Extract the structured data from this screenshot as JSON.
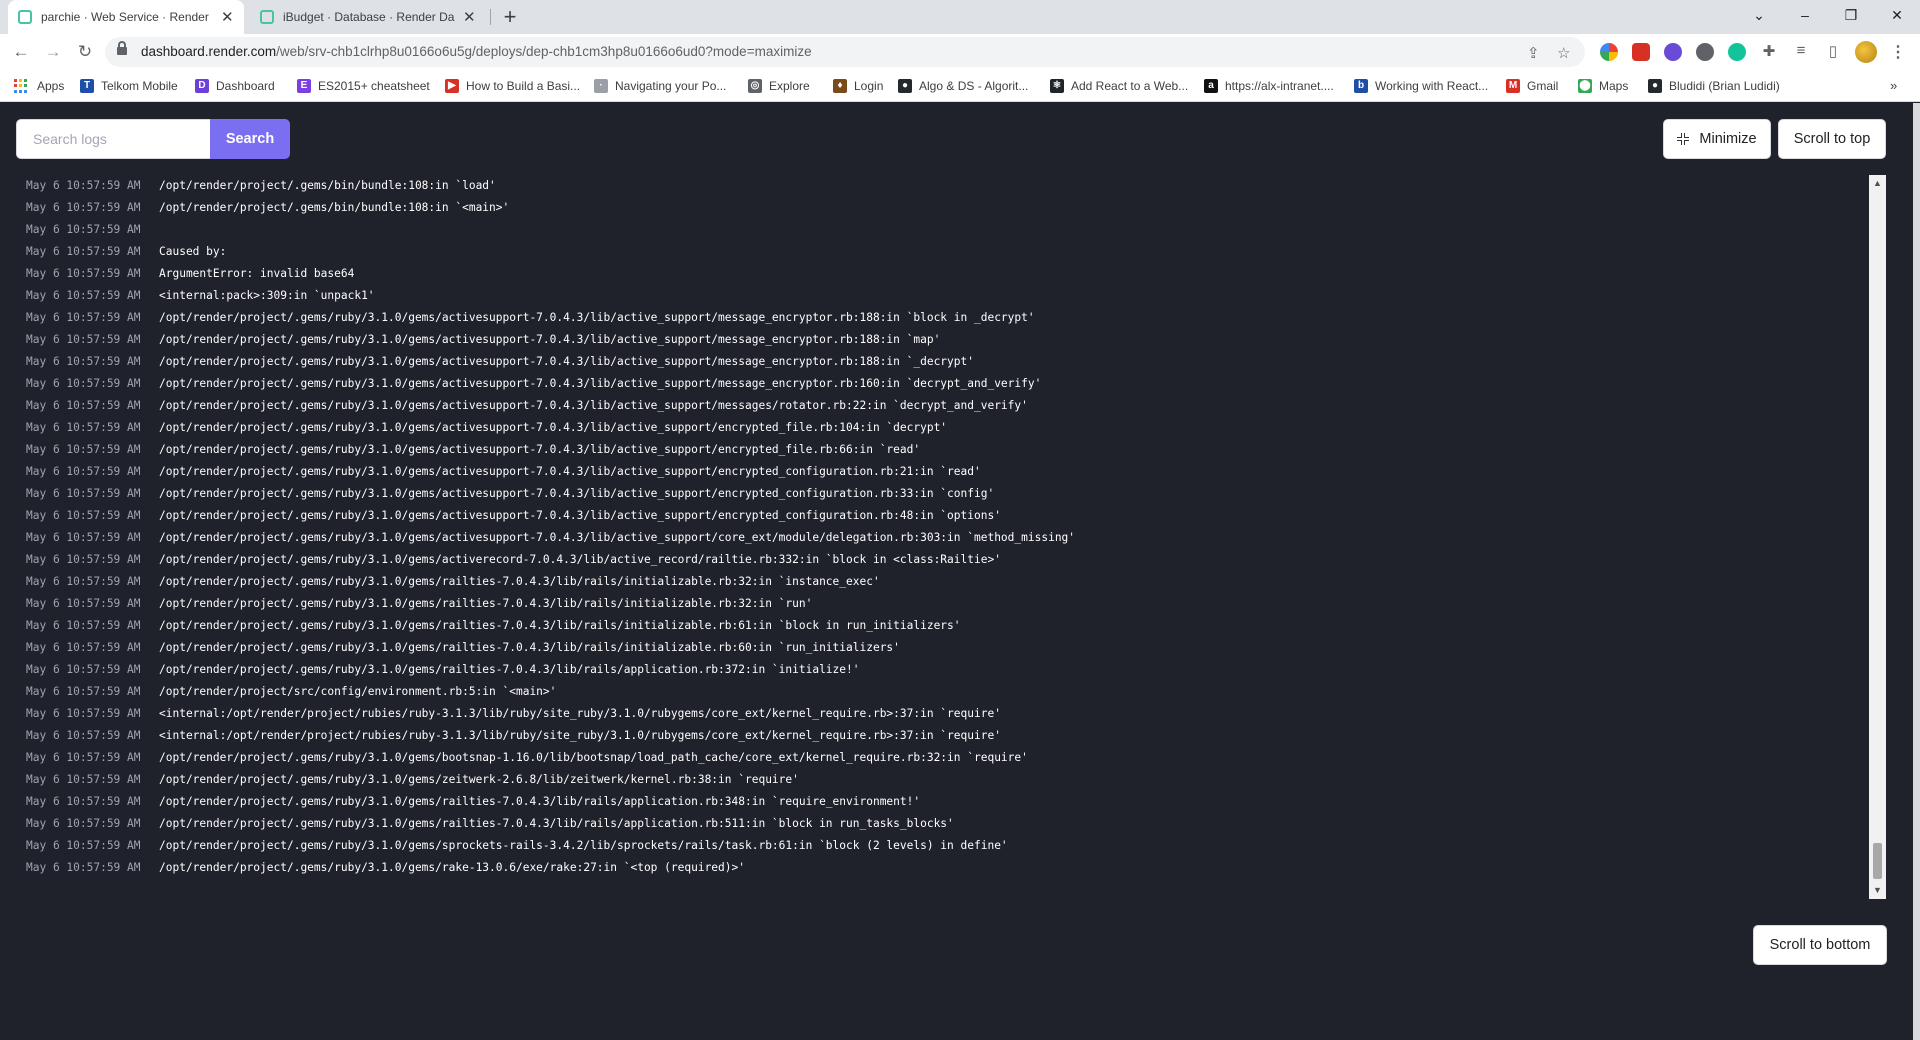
{
  "tabs": [
    {
      "title": "parchie · Web Service · Render D",
      "active": true
    },
    {
      "title": "iBudget · Database · Render Da",
      "active": false
    }
  ],
  "new_tab_glyph": "+",
  "window_controls": {
    "dropdown": "⌄",
    "minimize": "–",
    "restore": "❐",
    "close": "✕"
  },
  "address_bar": {
    "host": "dashboard.render.com",
    "path": "/web/srv-chb1clrhp8u0166o6u5g/deploys/dep-chb1cm3hp8u0166o6ud0?mode=maximize"
  },
  "bookmarks": [
    {
      "label": "Apps",
      "icon": "apps-grid-icon"
    },
    {
      "label": "Telkom Mobile",
      "icon": "telkom-icon",
      "color": "#1e4fa8",
      "glyph": "T"
    },
    {
      "label": "Dashboard",
      "icon": "dashboard-icon",
      "color": "#6c3fd8",
      "glyph": "D"
    },
    {
      "label": "ES2015+ cheatsheet",
      "icon": "devhints-icon",
      "color": "#7b3fe4",
      "glyph": "E"
    },
    {
      "label": "How to Build a Basi...",
      "icon": "youtube-like-icon",
      "color": "#d93025",
      "glyph": "▶"
    },
    {
      "label": "Navigating your Po...",
      "icon": "dots-icon",
      "color": "#9aa0a6",
      "glyph": "·"
    },
    {
      "label": "Explore",
      "icon": "compass-icon",
      "color": "#5f6368",
      "glyph": "◎"
    },
    {
      "label": "Login",
      "icon": "fire-icon",
      "color": "#7a4a1b",
      "glyph": "♦"
    },
    {
      "label": "Algo & DS - Algorit...",
      "icon": "github-icon",
      "color": "#24292e",
      "glyph": "●"
    },
    {
      "label": "Add React to a Web...",
      "icon": "react-icon",
      "color": "#20232a",
      "glyph": "⚛"
    },
    {
      "label": "https://alx-intranet....",
      "icon": "alx-icon",
      "color": "#111111",
      "glyph": "a"
    },
    {
      "label": "Working with React...",
      "icon": "ibm-icon",
      "color": "#1f4ea8",
      "glyph": "b"
    },
    {
      "label": "Gmail",
      "icon": "gmail-icon",
      "color": "#d93025",
      "glyph": "M"
    },
    {
      "label": "Maps",
      "icon": "maps-pin-icon",
      "color": "#34a853",
      "glyph": "⬤"
    },
    {
      "label": "Bludidi (Brian Ludidi)",
      "icon": "github-icon",
      "color": "#24292e",
      "glyph": "●"
    }
  ],
  "bookmarks_more": "»",
  "search": {
    "placeholder": "Search logs",
    "button_label": "Search"
  },
  "buttons": {
    "minimize": "Minimize",
    "scroll_to_top": "Scroll to top",
    "scroll_to_bottom": "Scroll to bottom"
  },
  "colors": {
    "page_bg": "#1f212b",
    "accent": "#7a6ff0",
    "timestamp": "#a0a3b1",
    "log_text": "#ffffff"
  },
  "logs": [
    {
      "ts": "May 6 10:57:59 AM",
      "msg": "/opt/render/project/.gems/bin/bundle:108:in `load'"
    },
    {
      "ts": "May 6 10:57:59 AM",
      "msg": "/opt/render/project/.gems/bin/bundle:108:in `<main>'"
    },
    {
      "ts": "May 6 10:57:59 AM",
      "msg": ""
    },
    {
      "ts": "May 6 10:57:59 AM",
      "msg": "Caused by:"
    },
    {
      "ts": "May 6 10:57:59 AM",
      "msg": "ArgumentError: invalid base64"
    },
    {
      "ts": "May 6 10:57:59 AM",
      "msg": "<internal:pack>:309:in `unpack1'"
    },
    {
      "ts": "May 6 10:57:59 AM",
      "msg": "/opt/render/project/.gems/ruby/3.1.0/gems/activesupport-7.0.4.3/lib/active_support/message_encryptor.rb:188:in `block in _decrypt'"
    },
    {
      "ts": "May 6 10:57:59 AM",
      "msg": "/opt/render/project/.gems/ruby/3.1.0/gems/activesupport-7.0.4.3/lib/active_support/message_encryptor.rb:188:in `map'"
    },
    {
      "ts": "May 6 10:57:59 AM",
      "msg": "/opt/render/project/.gems/ruby/3.1.0/gems/activesupport-7.0.4.3/lib/active_support/message_encryptor.rb:188:in `_decrypt'"
    },
    {
      "ts": "May 6 10:57:59 AM",
      "msg": "/opt/render/project/.gems/ruby/3.1.0/gems/activesupport-7.0.4.3/lib/active_support/message_encryptor.rb:160:in `decrypt_and_verify'"
    },
    {
      "ts": "May 6 10:57:59 AM",
      "msg": "/opt/render/project/.gems/ruby/3.1.0/gems/activesupport-7.0.4.3/lib/active_support/messages/rotator.rb:22:in `decrypt_and_verify'"
    },
    {
      "ts": "May 6 10:57:59 AM",
      "msg": "/opt/render/project/.gems/ruby/3.1.0/gems/activesupport-7.0.4.3/lib/active_support/encrypted_file.rb:104:in `decrypt'"
    },
    {
      "ts": "May 6 10:57:59 AM",
      "msg": "/opt/render/project/.gems/ruby/3.1.0/gems/activesupport-7.0.4.3/lib/active_support/encrypted_file.rb:66:in `read'"
    },
    {
      "ts": "May 6 10:57:59 AM",
      "msg": "/opt/render/project/.gems/ruby/3.1.0/gems/activesupport-7.0.4.3/lib/active_support/encrypted_configuration.rb:21:in `read'"
    },
    {
      "ts": "May 6 10:57:59 AM",
      "msg": "/opt/render/project/.gems/ruby/3.1.0/gems/activesupport-7.0.4.3/lib/active_support/encrypted_configuration.rb:33:in `config'"
    },
    {
      "ts": "May 6 10:57:59 AM",
      "msg": "/opt/render/project/.gems/ruby/3.1.0/gems/activesupport-7.0.4.3/lib/active_support/encrypted_configuration.rb:48:in `options'"
    },
    {
      "ts": "May 6 10:57:59 AM",
      "msg": "/opt/render/project/.gems/ruby/3.1.0/gems/activesupport-7.0.4.3/lib/active_support/core_ext/module/delegation.rb:303:in `method_missing'"
    },
    {
      "ts": "May 6 10:57:59 AM",
      "msg": "/opt/render/project/.gems/ruby/3.1.0/gems/activerecord-7.0.4.3/lib/active_record/railtie.rb:332:in `block in <class:Railtie>'"
    },
    {
      "ts": "May 6 10:57:59 AM",
      "msg": "/opt/render/project/.gems/ruby/3.1.0/gems/railties-7.0.4.3/lib/rails/initializable.rb:32:in `instance_exec'"
    },
    {
      "ts": "May 6 10:57:59 AM",
      "msg": "/opt/render/project/.gems/ruby/3.1.0/gems/railties-7.0.4.3/lib/rails/initializable.rb:32:in `run'"
    },
    {
      "ts": "May 6 10:57:59 AM",
      "msg": "/opt/render/project/.gems/ruby/3.1.0/gems/railties-7.0.4.3/lib/rails/initializable.rb:61:in `block in run_initializers'"
    },
    {
      "ts": "May 6 10:57:59 AM",
      "msg": "/opt/render/project/.gems/ruby/3.1.0/gems/railties-7.0.4.3/lib/rails/initializable.rb:60:in `run_initializers'"
    },
    {
      "ts": "May 6 10:57:59 AM",
      "msg": "/opt/render/project/.gems/ruby/3.1.0/gems/railties-7.0.4.3/lib/rails/application.rb:372:in `initialize!'"
    },
    {
      "ts": "May 6 10:57:59 AM",
      "msg": "/opt/render/project/src/config/environment.rb:5:in `<main>'"
    },
    {
      "ts": "May 6 10:57:59 AM",
      "msg": "<internal:/opt/render/project/rubies/ruby-3.1.3/lib/ruby/site_ruby/3.1.0/rubygems/core_ext/kernel_require.rb>:37:in `require'"
    },
    {
      "ts": "May 6 10:57:59 AM",
      "msg": "<internal:/opt/render/project/rubies/ruby-3.1.3/lib/ruby/site_ruby/3.1.0/rubygems/core_ext/kernel_require.rb>:37:in `require'"
    },
    {
      "ts": "May 6 10:57:59 AM",
      "msg": "/opt/render/project/.gems/ruby/3.1.0/gems/bootsnap-1.16.0/lib/bootsnap/load_path_cache/core_ext/kernel_require.rb:32:in `require'"
    },
    {
      "ts": "May 6 10:57:59 AM",
      "msg": "/opt/render/project/.gems/ruby/3.1.0/gems/zeitwerk-2.6.8/lib/zeitwerk/kernel.rb:38:in `require'"
    },
    {
      "ts": "May 6 10:57:59 AM",
      "msg": "/opt/render/project/.gems/ruby/3.1.0/gems/railties-7.0.4.3/lib/rails/application.rb:348:in `require_environment!'"
    },
    {
      "ts": "May 6 10:57:59 AM",
      "msg": "/opt/render/project/.gems/ruby/3.1.0/gems/railties-7.0.4.3/lib/rails/application.rb:511:in `block in run_tasks_blocks'"
    },
    {
      "ts": "May 6 10:57:59 AM",
      "msg": "/opt/render/project/.gems/ruby/3.1.0/gems/sprockets-rails-3.4.2/lib/sprockets/rails/task.rb:61:in `block (2 levels) in define'"
    },
    {
      "ts": "May 6 10:57:59 AM",
      "msg": "/opt/render/project/.gems/ruby/3.1.0/gems/rake-13.0.6/exe/rake:27:in `<top (required)>'"
    }
  ]
}
